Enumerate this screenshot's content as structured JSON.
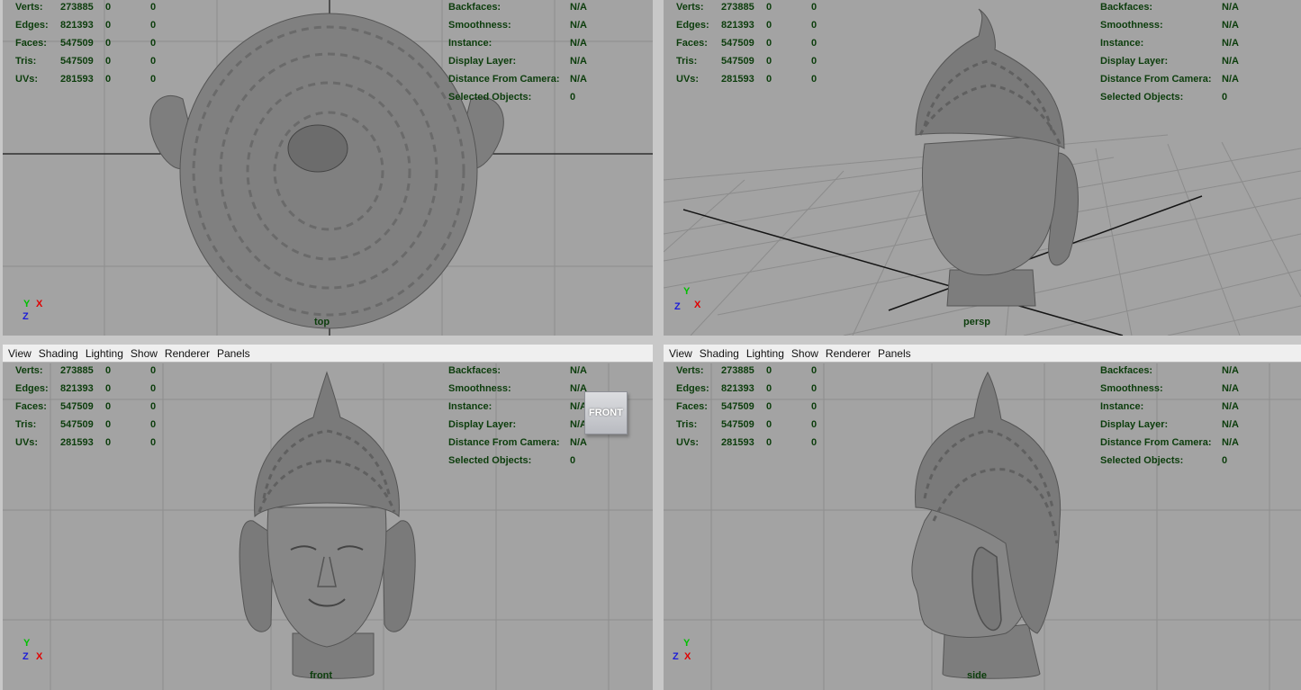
{
  "menu": [
    "View",
    "Shading",
    "Lighting",
    "Show",
    "Renderer",
    "Panels"
  ],
  "stats": {
    "rows": [
      {
        "label": "Verts:",
        "a": "273885",
        "b": "0",
        "c": "0"
      },
      {
        "label": "Edges:",
        "a": "821393",
        "b": "0",
        "c": "0"
      },
      {
        "label": "Faces:",
        "a": "547509",
        "b": "0",
        "c": "0"
      },
      {
        "label": "Tris:",
        "a": "547509",
        "b": "0",
        "c": "0"
      },
      {
        "label": "UVs:",
        "a": "281593",
        "b": "0",
        "c": "0"
      }
    ],
    "right": [
      {
        "label": "Backfaces:",
        "value": "N/A"
      },
      {
        "label": "Smoothness:",
        "value": "N/A"
      },
      {
        "label": "Instance:",
        "value": "N/A"
      },
      {
        "label": "Display Layer:",
        "value": "N/A"
      },
      {
        "label": "Distance From Camera:",
        "value": "N/A"
      },
      {
        "label": "Selected Objects:",
        "value": "0"
      }
    ]
  },
  "viewports": [
    {
      "camera": "top",
      "axes": [
        "Y",
        "X",
        "Z"
      ]
    },
    {
      "camera": "persp",
      "axes": [
        "Y",
        "Z",
        "X"
      ]
    },
    {
      "camera": "front",
      "axes": [
        "Y",
        "Z",
        "X"
      ]
    },
    {
      "camera": "side",
      "axes": [
        "Y",
        "Z",
        "X"
      ]
    }
  ],
  "viewcube_label": "FRONT",
  "colors": {
    "viewport_bg": "#a3a3a3",
    "hud_text": "#0c3d0c",
    "model": "#7d7d7d",
    "grid": "#8c8c8c"
  }
}
